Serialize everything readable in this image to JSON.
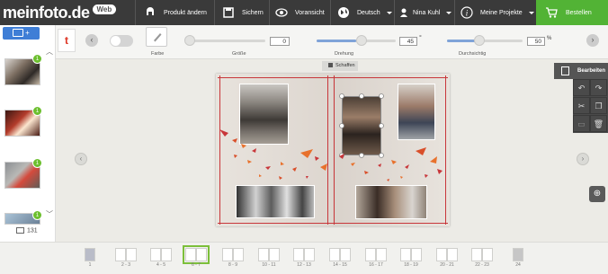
{
  "logo": {
    "text": "meinfoto.de",
    "badge": "Web"
  },
  "nav": {
    "items": [
      {
        "label": "Produkt ändern",
        "icon": "product-icon"
      },
      {
        "label": "Sichern",
        "icon": "save-icon"
      },
      {
        "label": "Voransicht",
        "icon": "eye-icon"
      },
      {
        "label": "Deutsch",
        "icon": "globe-icon"
      },
      {
        "label": "Nina Kuhl",
        "icon": "user-icon"
      },
      {
        "label": "Meine Projekte",
        "icon": "info-icon"
      }
    ],
    "order": "Bestellen"
  },
  "toolbar": {
    "color_label": "Farbe",
    "size_label": "Größe",
    "size_value": "0",
    "rotation_label": "Drehung",
    "rotation_value": "45",
    "rotation_unit": "°",
    "opacity_label": "Durchsichtig",
    "opacity_value": "50",
    "opacity_unit": "%",
    "add_label": "+",
    "tool_letter": "t"
  },
  "sidebar": {
    "photo_count": "131",
    "badges": [
      "1",
      "1",
      "1",
      "1"
    ]
  },
  "canvas": {
    "schaffen": "Schaffen",
    "bearbeiten": "Bearbeiten"
  },
  "pages": [
    "1",
    "2 - 3",
    "4 - 5",
    "6 - 7",
    "8 - 9",
    "10 - 11",
    "12 - 13",
    "14 - 15",
    "16 - 17",
    "18 - 19",
    "20 - 21",
    "22 - 23",
    "24"
  ],
  "colors": {
    "accent": "#3f7ed6",
    "order": "#52b335",
    "topbar": "#3a3a3a",
    "frame": "#c8363a"
  }
}
